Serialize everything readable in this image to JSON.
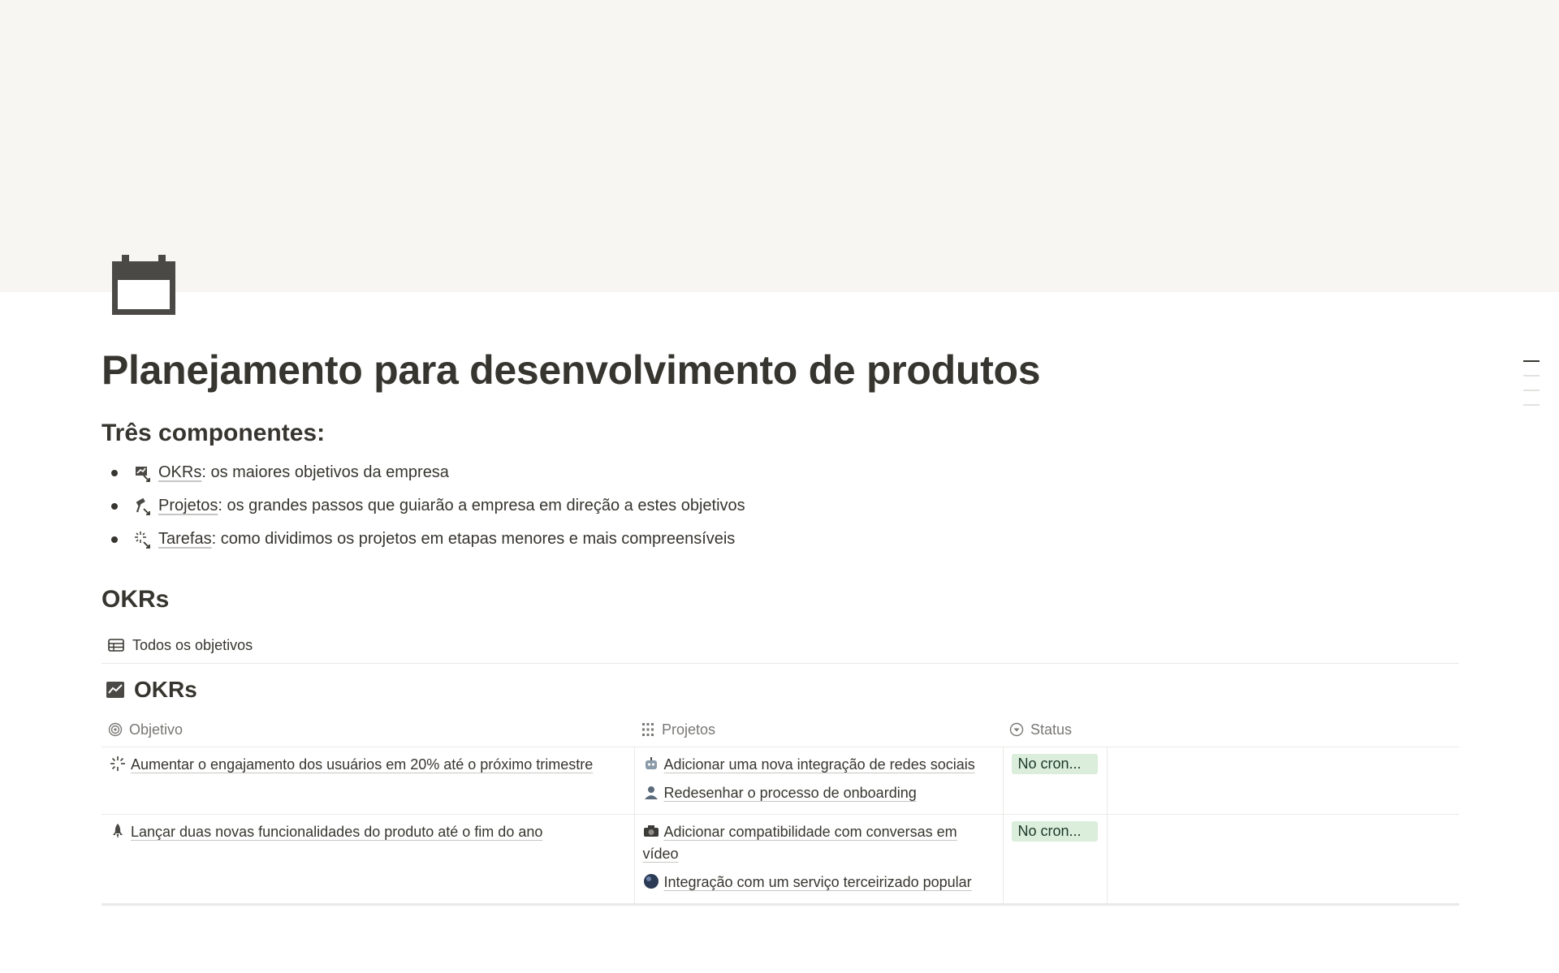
{
  "page": {
    "title": "Planejamento para desenvolvimento de produtos",
    "icon": "calendar-icon"
  },
  "components": {
    "heading": "Três componentes:",
    "items": [
      {
        "icon": "okr-chart-icon",
        "link": "OKRs",
        "text": ": os maiores objetivos da empresa"
      },
      {
        "icon": "hammer-icon",
        "link": "Projetos",
        "text": ": os grandes passos que guiarão a empresa em direção a estes objetivos"
      },
      {
        "icon": "sparkle-icon",
        "link": "Tarefas",
        "text": ": como dividimos os projetos em etapas menores e mais compreensíveis"
      }
    ]
  },
  "okrs_section": {
    "heading": "OKRs",
    "view_tab": "Todos os objetivos",
    "db_title": "OKRs",
    "columns": {
      "objetivo": "Objetivo",
      "projetos": "Projetos",
      "status": "Status"
    },
    "rows": [
      {
        "objetivo": "Aumentar o engajamento dos usuários em 20% até o próximo trimestre",
        "objetivo_icon": "sparkle-icon",
        "projetos": [
          {
            "icon": "robot-icon",
            "text": "Adicionar uma nova integração de redes sociais"
          },
          {
            "icon": "person-icon",
            "text": "Redesenhar o processo de onboarding"
          }
        ],
        "status": "No cron..."
      },
      {
        "objetivo": "Lançar duas novas funcionalidades do produto até o fim do ano",
        "objetivo_icon": "rocket-icon",
        "projetos": [
          {
            "icon": "camera-icon",
            "text": "Adicionar compatibilidade com conversas em vídeo"
          },
          {
            "icon": "globe-icon",
            "text": "Integração com um serviço terceirizado popular"
          }
        ],
        "status": "No cron..."
      }
    ]
  },
  "colors": {
    "cover": "#f8f6f2",
    "text": "#37352f",
    "muted": "#787774",
    "status_bg": "#dbeddb",
    "status_text": "#1c3829"
  }
}
